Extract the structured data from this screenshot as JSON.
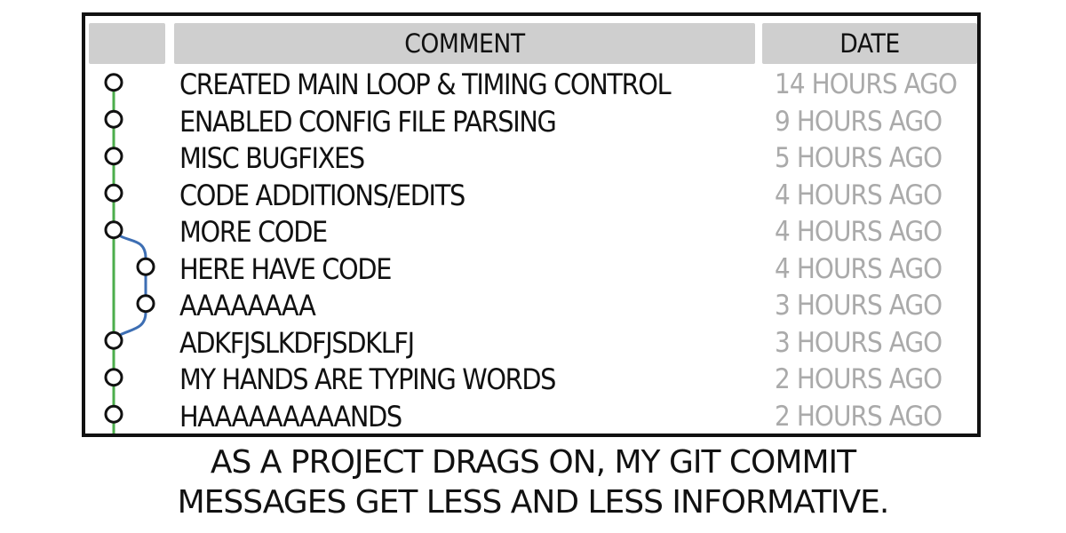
{
  "table": {
    "headers": {
      "graph": "",
      "comment": "COMMENT",
      "date": "DATE"
    },
    "rows": [
      {
        "comment": "CREATED MAIN LOOP & TIMING CONTROL",
        "date": "14 HOURS AGO",
        "branch": "main"
      },
      {
        "comment": "ENABLED CONFIG FILE PARSING",
        "date": "9 HOURS AGO",
        "branch": "main"
      },
      {
        "comment": "MISC BUGFIXES",
        "date": "5 HOURS AGO",
        "branch": "main"
      },
      {
        "comment": "CODE ADDITIONS/EDITS",
        "date": "4 HOURS AGO",
        "branch": "main"
      },
      {
        "comment": "MORE CODE",
        "date": "4 HOURS AGO",
        "branch": "main"
      },
      {
        "comment": "HERE HAVE CODE",
        "date": "4 HOURS AGO",
        "branch": "side"
      },
      {
        "comment": "AAAAAAAA",
        "date": "3 HOURS AGO",
        "branch": "side"
      },
      {
        "comment": "ADKFJSLKDFJSDKLFJ",
        "date": "3 HOURS AGO",
        "branch": "main"
      },
      {
        "comment": "MY HANDS ARE TYPING WORDS",
        "date": "2 HOURS AGO",
        "branch": "main"
      },
      {
        "comment": "HAAAAAAAAANDS",
        "date": "2 HOURS AGO",
        "branch": "main"
      }
    ]
  },
  "graph_colors": {
    "main_branch": "#4cae4c",
    "side_branch": "#3d6eb3",
    "commit_node": "#111111"
  },
  "caption": {
    "line1": "AS A PROJECT DRAGS ON, MY GIT COMMIT",
    "line2": "MESSAGES GET LESS AND LESS INFORMATIVE."
  }
}
